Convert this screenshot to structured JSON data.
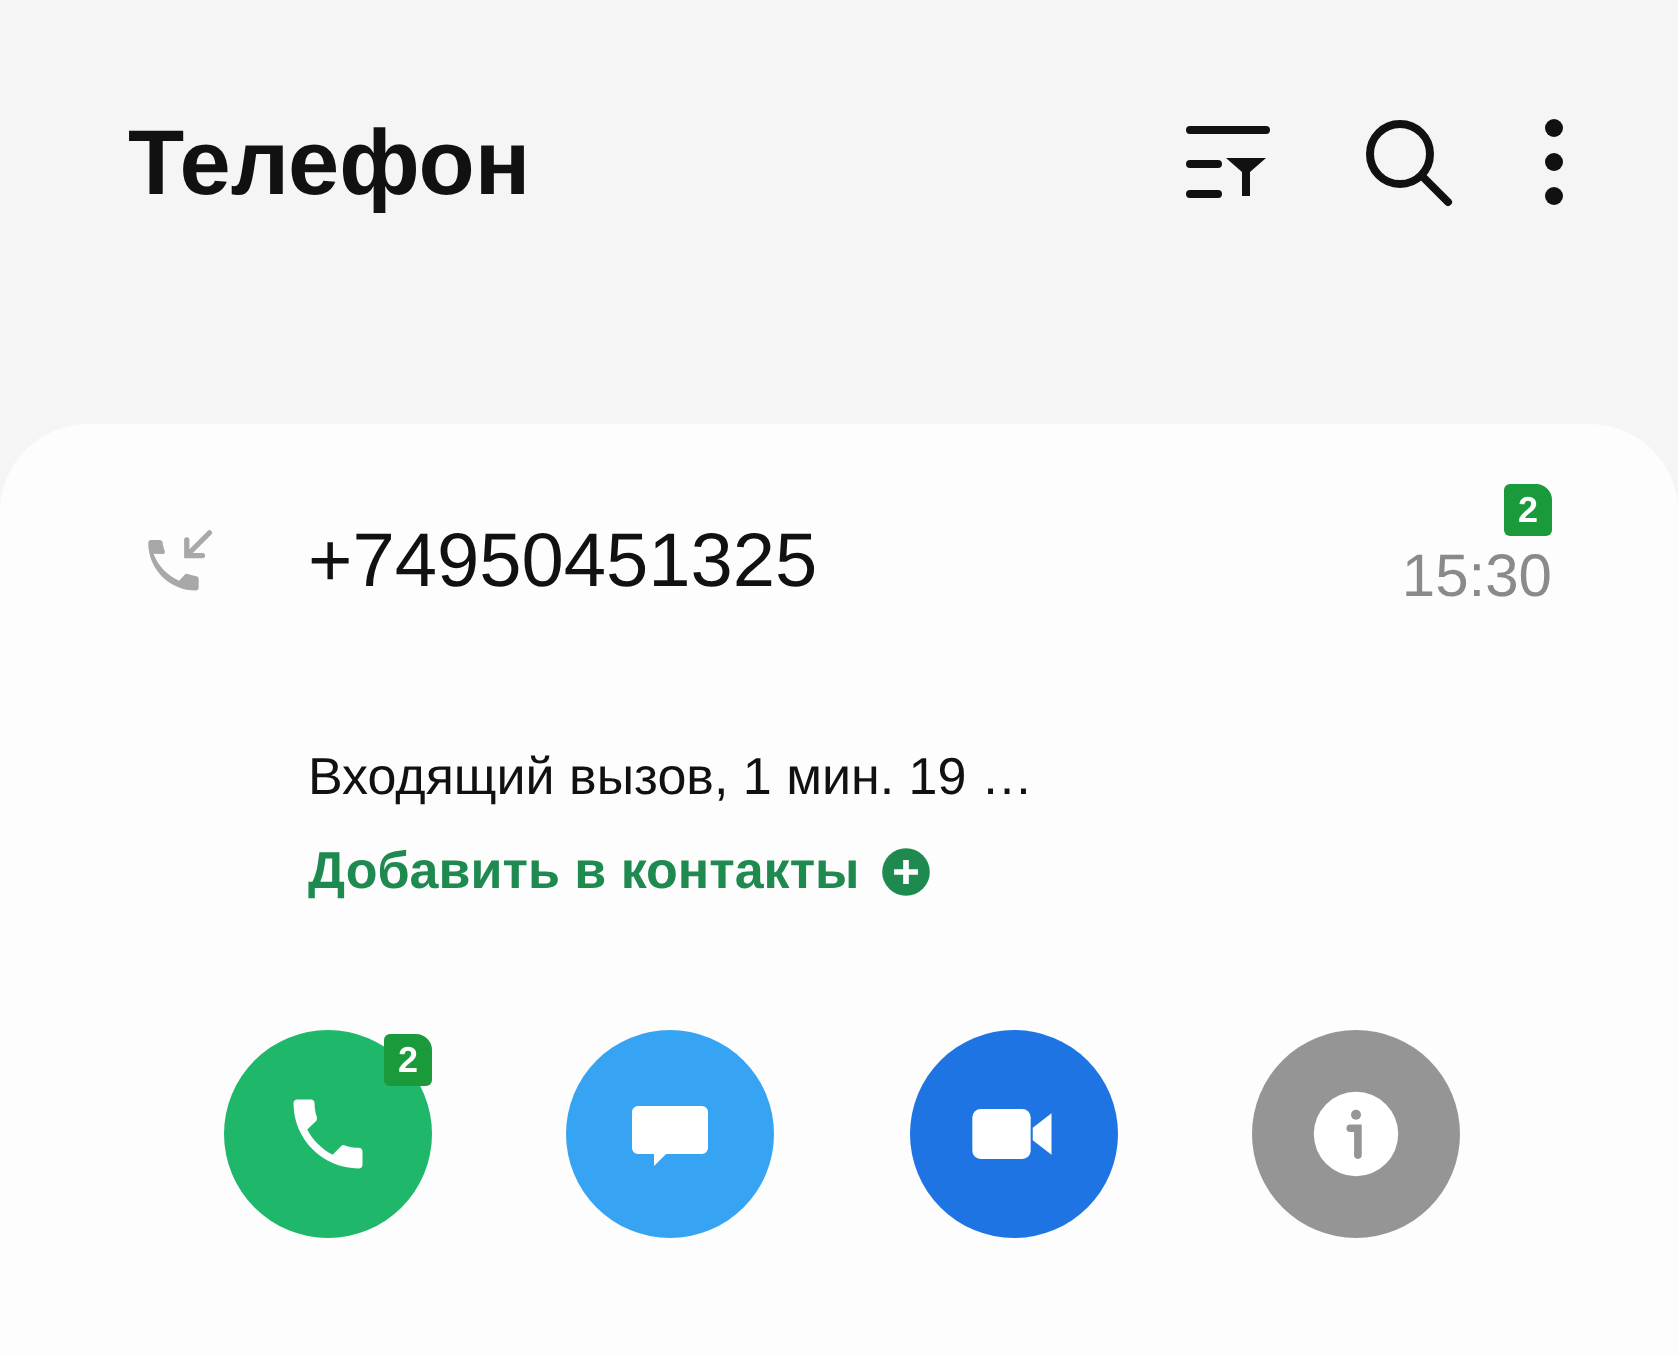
{
  "header": {
    "title": "Телефон"
  },
  "call_entry": {
    "number": "+74950451325",
    "sim_badge": "2",
    "time": "15:30",
    "description": "Входящий вызов, 1 мин. 19 …",
    "add_contact": "Добавить в контакты",
    "actions": [
      {
        "kind": "call",
        "color": "#1fb76a",
        "sim_badge": "2"
      },
      {
        "kind": "message",
        "color": "#36a4f2"
      },
      {
        "kind": "video",
        "color": "#1f74e3"
      },
      {
        "kind": "info",
        "color": "#959595"
      }
    ]
  }
}
